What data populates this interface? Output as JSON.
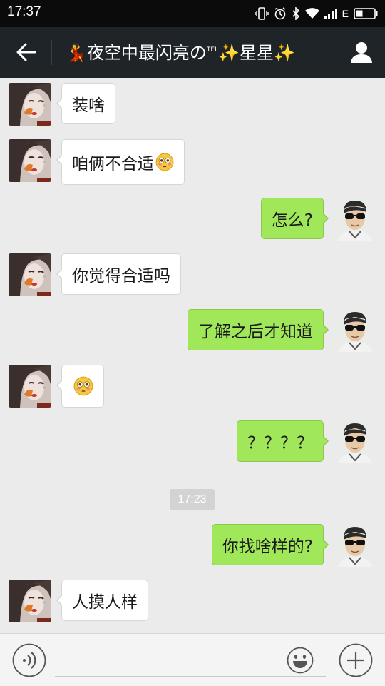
{
  "status_bar": {
    "time": "17:37",
    "network": "E"
  },
  "header": {
    "title_prefix": "💃夜空中最闪亮の",
    "title_tel": "TEL",
    "title_spark1": "✨",
    "title_name": "星星",
    "title_spark2": "✨"
  },
  "messages": [
    {
      "side": "left",
      "text": "装啥"
    },
    {
      "side": "left",
      "text": "咱俩不合适",
      "emoji": "flushed-face-icon"
    },
    {
      "side": "right",
      "text": "怎么?"
    },
    {
      "side": "left",
      "text": "你觉得合适吗"
    },
    {
      "side": "right",
      "text": "了解之后才知道"
    },
    {
      "side": "left",
      "text": "",
      "emoji": "pleading-face-icon"
    },
    {
      "side": "right",
      "text": "？？？？"
    },
    {
      "side": "right",
      "text": "你找啥样的?"
    },
    {
      "side": "left",
      "text": "人摸人样"
    }
  ],
  "timestamp": "17:23",
  "input": {
    "value": "",
    "placeholder": ""
  },
  "colors": {
    "header_bg": "#1f2428",
    "bubble_out": "#a0e75a",
    "bubble_in": "#ffffff",
    "chat_bg": "#ebebeb"
  }
}
